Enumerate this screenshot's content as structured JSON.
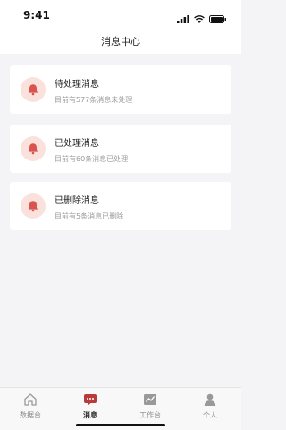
{
  "status_bar": {
    "time": "9:41",
    "icons": [
      "signal-icon",
      "wifi-icon",
      "battery-icon"
    ]
  },
  "header": {
    "title": "消息中心"
  },
  "messages": [
    {
      "title": "待处理消息",
      "description": "目前有577条消息未处理",
      "icon": "bell-icon"
    },
    {
      "title": "已处理消息",
      "description": "目前有60条消息已处理",
      "icon": "bell-icon"
    },
    {
      "title": "已删除消息",
      "description": "目前有5条消息已删除",
      "icon": "bell-icon"
    }
  ],
  "tabbar": {
    "items": [
      {
        "label": "数据台",
        "icon": "home-icon",
        "active": false
      },
      {
        "label": "消息",
        "icon": "message-icon",
        "active": true
      },
      {
        "label": "工作台",
        "icon": "chart-icon",
        "active": false
      },
      {
        "label": "个人",
        "icon": "person-icon",
        "active": false
      }
    ]
  },
  "colors": {
    "accent": "#b83a3a",
    "bell_icon": "#d9534f",
    "icon_background": "#fbe1dc",
    "page_background": "#f4f4f6"
  }
}
